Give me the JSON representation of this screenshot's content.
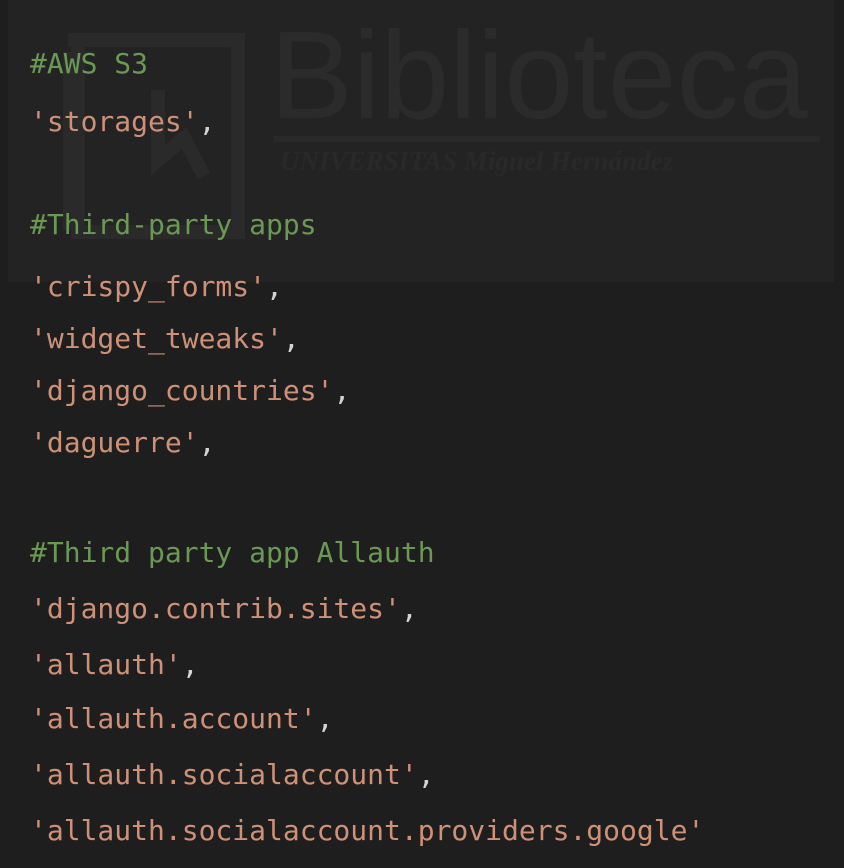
{
  "colors": {
    "background": "#1e1e1e",
    "comment": "#6a9955",
    "string": "#ce9178",
    "punctuation": "#d4d4d4"
  },
  "watermark": {
    "title": "Biblioteca",
    "subtitle": "UNIVERSITAS Miguel Hernández"
  },
  "code": {
    "lines": [
      {
        "kind": "comment",
        "text": "#AWS S3"
      },
      {
        "kind": "string",
        "text": "'storages'",
        "punct": ","
      },
      {
        "kind": "blank",
        "text": ""
      },
      {
        "kind": "comment",
        "text": "#Third-party apps"
      },
      {
        "kind": "string",
        "text": "'crispy_forms'",
        "punct": ","
      },
      {
        "kind": "string",
        "text": "'widget_tweaks'",
        "punct": ","
      },
      {
        "kind": "string",
        "text": "'django_countries'",
        "punct": ","
      },
      {
        "kind": "string",
        "text": "'daguerre'",
        "punct": ","
      },
      {
        "kind": "blank",
        "text": ""
      },
      {
        "kind": "comment",
        "text": "#Third party app Allauth"
      },
      {
        "kind": "string",
        "text": "'django.contrib.sites'",
        "punct": ","
      },
      {
        "kind": "string",
        "text": "'allauth'",
        "punct": ","
      },
      {
        "kind": "string",
        "text": "'allauth.account'",
        "punct": ","
      },
      {
        "kind": "string",
        "text": "'allauth.socialaccount'",
        "punct": ","
      },
      {
        "kind": "string",
        "text": "'allauth.socialaccount.providers.google'",
        "punct": ""
      }
    ]
  }
}
